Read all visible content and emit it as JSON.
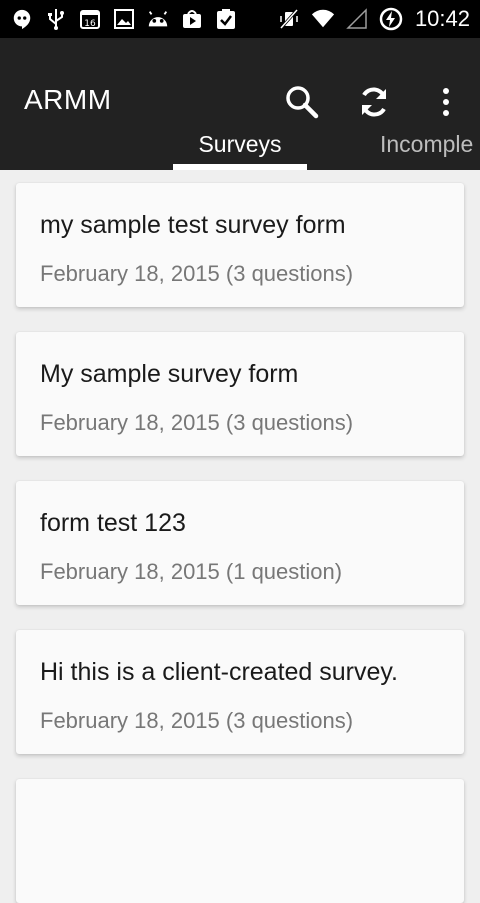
{
  "status_bar": {
    "time": "10:42",
    "icons_left": [
      "hangouts-icon",
      "usb-icon",
      "calendar-icon",
      "gallery-icon",
      "android-icon",
      "play-store-icon",
      "task-check-icon"
    ],
    "icons_right": [
      "vibrate-off-icon",
      "wifi-icon",
      "signal-icon",
      "battery-charging-icon"
    ],
    "calendar_day": "16"
  },
  "app_bar": {
    "title": "ARMM",
    "actions": [
      "search-icon",
      "refresh-icon",
      "overflow-menu-icon"
    ]
  },
  "tabs": [
    {
      "label": "Surveys",
      "active": true
    },
    {
      "label": "Incomple",
      "active": false
    }
  ],
  "surveys": [
    {
      "title": "my sample test survey form",
      "meta": "February 18, 2015 (3 questions)"
    },
    {
      "title": "My sample survey form",
      "meta": "February 18, 2015 (3 questions)"
    },
    {
      "title": "form test 123",
      "meta": "February 18, 2015 (1 question)"
    },
    {
      "title": "Hi this is a client-created survey.",
      "meta": "February 18, 2015 (3 questions)"
    }
  ],
  "colors": {
    "status_bar_bg": "#000000",
    "app_bar_bg": "#222222",
    "list_bg": "#efefef",
    "card_bg": "#fafafa",
    "title_text": "#1a1a1a",
    "meta_text": "#777777"
  }
}
